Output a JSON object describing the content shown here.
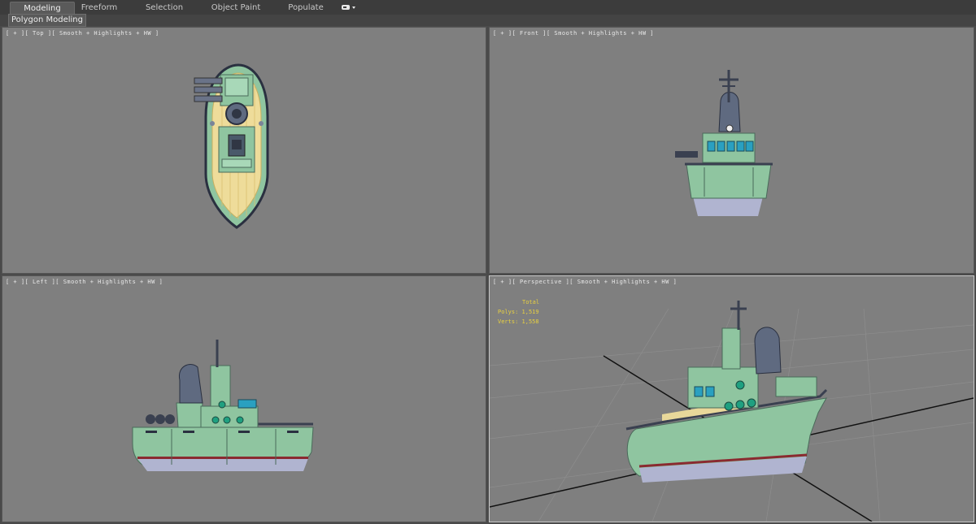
{
  "ribbon": {
    "tabs": [
      {
        "label": "Modeling",
        "active": true
      },
      {
        "label": "Freeform",
        "active": false
      },
      {
        "label": "Selection",
        "active": false
      },
      {
        "label": "Object Paint",
        "active": false
      },
      {
        "label": "Populate",
        "active": false
      }
    ],
    "panel_label": "Polygon Modeling"
  },
  "viewports": {
    "top": {
      "label": "[ + ][ Top ][ Smooth + Highlights + HW ]"
    },
    "front": {
      "label": "[ + ][ Front ][ Smooth + Highlights + HW ]"
    },
    "left": {
      "label": "[ + ][ Left ][ Smooth + Highlights + HW ]"
    },
    "perspective": {
      "label": "[ + ][ Perspective ][ Smooth + Highlights + HW ]"
    }
  },
  "stats": {
    "header": "Total",
    "polys_label": "Polys:",
    "polys_value": "1,519",
    "verts_label": "Verts:",
    "verts_value": "1,558"
  },
  "colors": {
    "hull": "#8fc5a0",
    "hull_dark": "#5a8a6c",
    "deck": "#e8d89a",
    "funnel": "#5f6a80",
    "window": "#2aa0c0",
    "waterline": "#b0b4d0",
    "viewport_bg": "#7f7f7f"
  }
}
